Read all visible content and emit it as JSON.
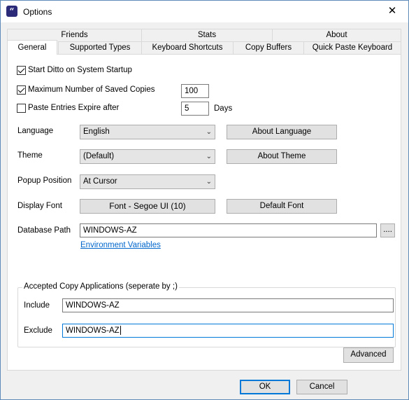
{
  "window": {
    "title": "Options",
    "app_icon_glyph": "“",
    "close_glyph": "✕"
  },
  "tabs": {
    "row_back": [
      "Friends",
      "Stats",
      "About"
    ],
    "row_front": [
      "General",
      "Supported Types",
      "Keyboard Shortcuts",
      "Copy Buffers",
      "Quick Paste Keyboard"
    ],
    "active": "General"
  },
  "general": {
    "start_on_startup": {
      "label": "Start Ditto on System Startup",
      "checked": true
    },
    "max_saved": {
      "label": "Maximum Number of Saved Copies",
      "checked": true,
      "value": "100"
    },
    "expire": {
      "label": "Paste Entries Expire after",
      "checked": false,
      "value": "5",
      "unit": "Days"
    },
    "language": {
      "label": "Language",
      "value": "English",
      "button": "About Language"
    },
    "theme": {
      "label": "Theme",
      "value": "(Default)",
      "button": "About Theme"
    },
    "popup_position": {
      "label": "Popup Position",
      "value": "At Cursor"
    },
    "display_font": {
      "label": "Display Font",
      "button": "Font - Segoe UI (10)",
      "default_button": "Default Font"
    },
    "database_path": {
      "label": "Database Path",
      "value": "WINDOWS-AZ",
      "browse": "....",
      "env_link": "Environment Variables"
    },
    "accepted_apps": {
      "title": "Accepted Copy Applications (seperate by ;)",
      "include_label": "Include",
      "include_value": "WINDOWS-AZ",
      "exclude_label": "Exclude",
      "exclude_value": "WINDOWS-AZ"
    },
    "advanced_button": "Advanced"
  },
  "footer": {
    "ok": "OK",
    "cancel": "Cancel"
  },
  "icons": {
    "app": "ditto-app-icon",
    "close": "close-icon",
    "dropdown": "chevron-down-icon",
    "cursor": "mouse-cursor-icon"
  },
  "colors": {
    "accent": "#0078d7",
    "link": "#0066cc",
    "title_border": "#5f8bb8"
  }
}
